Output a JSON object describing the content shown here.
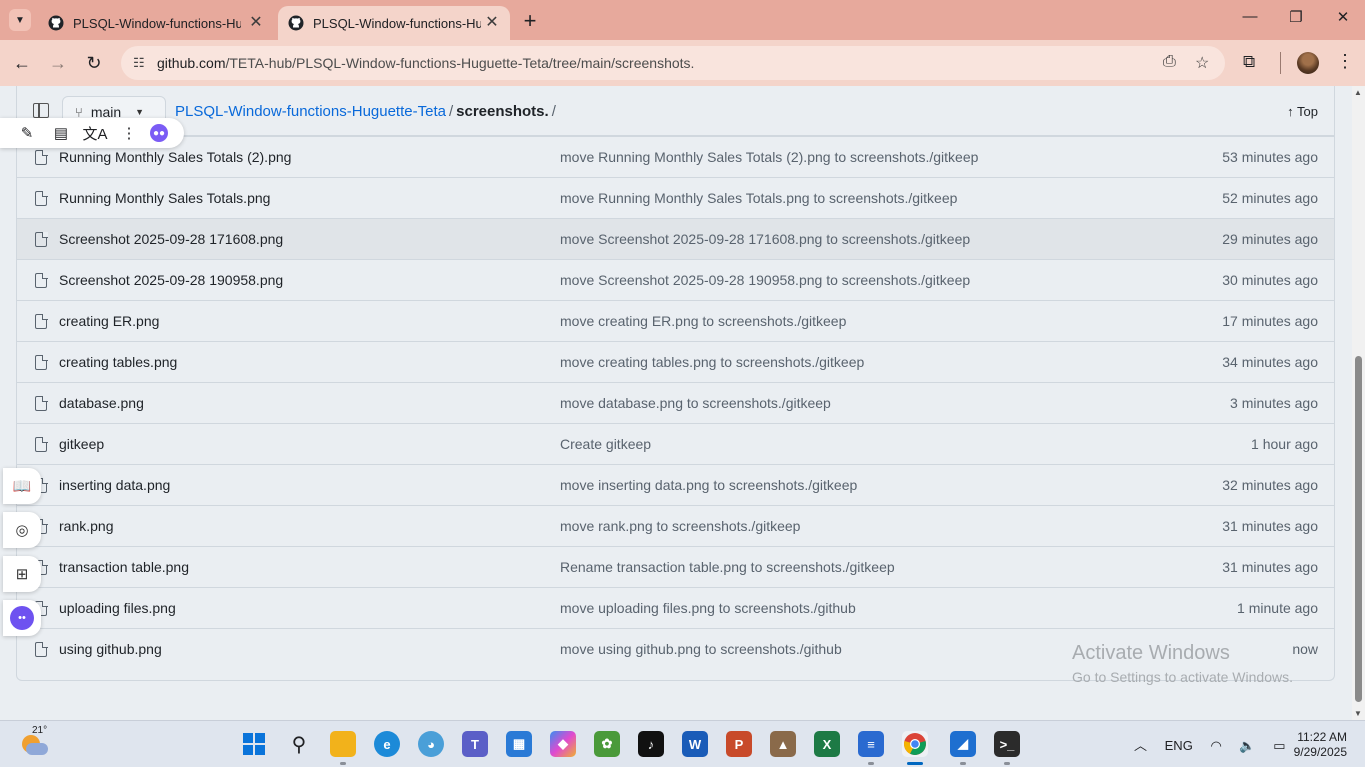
{
  "browser": {
    "tabs": [
      {
        "title": "PLSQL-Window-functions-Huguette-Teta",
        "active": false
      },
      {
        "title": "PLSQL-Window-functions-Huguette-Teta",
        "active": true
      }
    ],
    "url_host": "github.com",
    "url_path": "/TETA-hub/PLSQL-Window-functions-Huguette-Teta/tree/main/screenshots."
  },
  "repo_header": {
    "branch": "main",
    "repo_name": "PLSQL-Window-functions-Huguette-Teta",
    "separator": "/",
    "current_folder": "screenshots.",
    "trailing_separator": "/",
    "top_label": "Top"
  },
  "files": [
    {
      "name": "Running Monthly Sales Totals (2).png",
      "message": "move Running Monthly Sales Totals (2).png to screenshots./gitkeep",
      "time": "53 minutes ago"
    },
    {
      "name": "Running Monthly Sales Totals.png",
      "message": "move Running Monthly Sales Totals.png to screenshots./gitkeep",
      "time": "52 minutes ago"
    },
    {
      "name": "Screenshot 2025-09-28 171608.png",
      "message": "move Screenshot 2025-09-28 171608.png to screenshots./gitkeep",
      "time": "29 minutes ago"
    },
    {
      "name": "Screenshot 2025-09-28 190958.png",
      "message": "move Screenshot 2025-09-28 190958.png to screenshots./gitkeep",
      "time": "30 minutes ago"
    },
    {
      "name": "creating ER.png",
      "message": "move creating ER.png to screenshots./gitkeep",
      "time": "17 minutes ago"
    },
    {
      "name": "creating tables.png",
      "message": "move creating tables.png to screenshots./gitkeep",
      "time": "34 minutes ago"
    },
    {
      "name": "database.png",
      "message": "move database.png to screenshots./gitkeep",
      "time": "3 minutes ago"
    },
    {
      "name": "gitkeep",
      "message": "Create gitkeep",
      "time": "1 hour ago"
    },
    {
      "name": "inserting data.png",
      "message": "move inserting data.png to screenshots./gitkeep",
      "time": "32 minutes ago"
    },
    {
      "name": "rank.png",
      "message": "move rank.png to screenshots./gitkeep",
      "time": "31 minutes ago"
    },
    {
      "name": "transaction table.png",
      "message": "Rename transaction table.png to screenshots./gitkeep",
      "time": "31 minutes ago"
    },
    {
      "name": "uploading files.png",
      "message": "move uploading files.png to screenshots./github",
      "time": "1 minute ago"
    },
    {
      "name": "using github.png",
      "message": "move using github.png to screenshots./github",
      "time": "now"
    }
  ],
  "watermark": {
    "line1": "Activate Windows",
    "line2": "Go to Settings to activate Windows."
  },
  "taskbar": {
    "temperature": "21°",
    "language": "ENG",
    "time": "11:22 AM",
    "date": "9/29/2025"
  },
  "colors": {
    "titlebar": "#e7a99c",
    "toolbar": "#f4d4ca",
    "link": "#0969da",
    "page_bg": "#eaeef2"
  }
}
